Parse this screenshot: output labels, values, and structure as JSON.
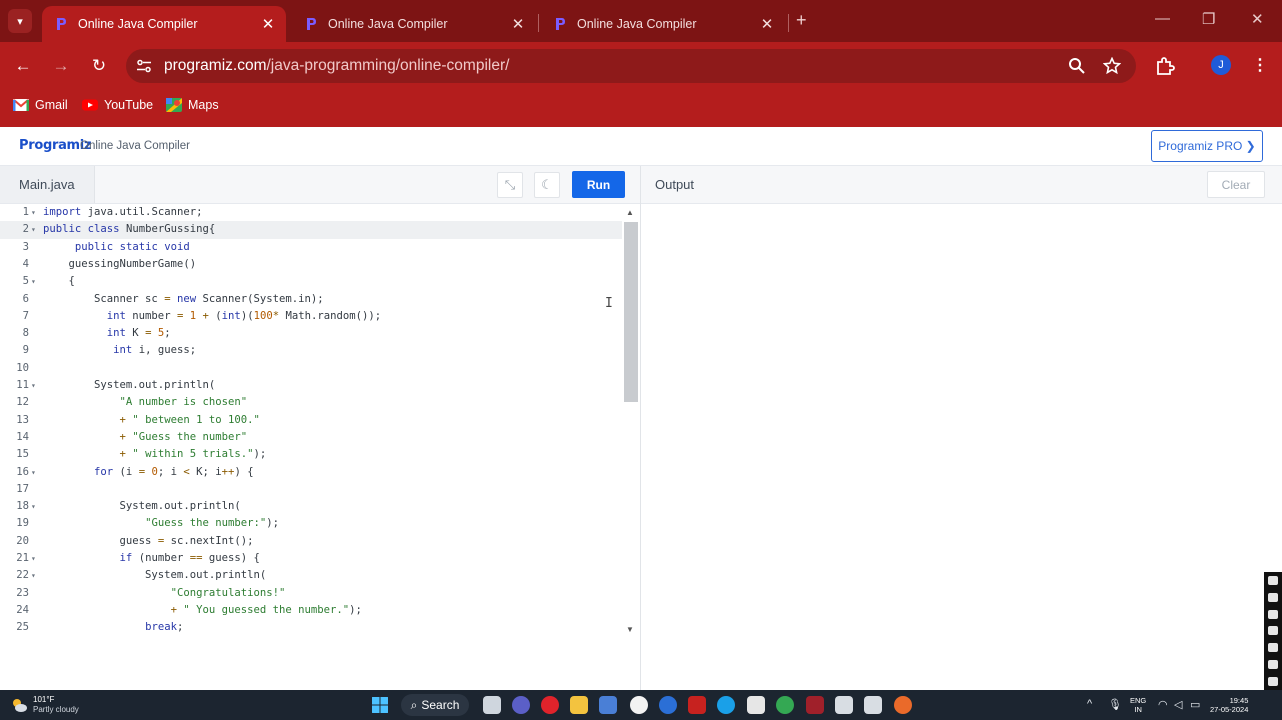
{
  "browser": {
    "tabs": [
      {
        "title": "Online Java Compiler",
        "active": true
      },
      {
        "title": "Online Java Compiler",
        "active": false
      },
      {
        "title": "Online Java Compiler",
        "active": false
      }
    ],
    "url_host": "programiz.com",
    "url_path": "/java-programming/online-compiler/",
    "profile_initial": "J",
    "bookmarks": [
      "Gmail",
      "YouTube",
      "Maps"
    ]
  },
  "site": {
    "logo": "Programiz",
    "title": "Online Java Compiler",
    "pro_button": "Programiz PRO ❯"
  },
  "editor": {
    "file_tab": "Main.java",
    "run_label": "Run",
    "output_label": "Output",
    "clear_label": "Clear",
    "lines": [
      {
        "n": "1",
        "fold": true,
        "text": "import java.util.Scanner;"
      },
      {
        "n": "2",
        "fold": true,
        "text": "public class NumberGussing{"
      },
      {
        "n": "3",
        "fold": false,
        "text": "     public static void"
      },
      {
        "n": "4",
        "fold": false,
        "text": "    guessingNumberGame()"
      },
      {
        "n": "5",
        "fold": true,
        "text": "    {"
      },
      {
        "n": "6",
        "fold": false,
        "text": "        Scanner sc = new Scanner(System.in);"
      },
      {
        "n": "7",
        "fold": false,
        "text": "          int number = 1 + (int)(100* Math.random());"
      },
      {
        "n": "8",
        "fold": false,
        "text": "          int K = 5;"
      },
      {
        "n": "9",
        "fold": false,
        "text": "           int i, guess;"
      },
      {
        "n": "10",
        "fold": false,
        "text": ""
      },
      {
        "n": "11",
        "fold": true,
        "text": "        System.out.println("
      },
      {
        "n": "12",
        "fold": false,
        "text": "            \"A number is chosen\""
      },
      {
        "n": "13",
        "fold": false,
        "text": "            + \" between 1 to 100.\""
      },
      {
        "n": "14",
        "fold": false,
        "text": "            + \"Guess the number\""
      },
      {
        "n": "15",
        "fold": false,
        "text": "            + \" within 5 trials.\");"
      },
      {
        "n": "16",
        "fold": true,
        "text": "        for (i = 0; i < K; i++) {"
      },
      {
        "n": "17",
        "fold": false,
        "text": ""
      },
      {
        "n": "18",
        "fold": true,
        "text": "            System.out.println("
      },
      {
        "n": "19",
        "fold": false,
        "text": "                \"Guess the number:\");"
      },
      {
        "n": "20",
        "fold": false,
        "text": "            guess = sc.nextInt();"
      },
      {
        "n": "21",
        "fold": true,
        "text": "            if (number == guess) {"
      },
      {
        "n": "22",
        "fold": true,
        "text": "                System.out.println("
      },
      {
        "n": "23",
        "fold": false,
        "text": "                    \"Congratulations!\""
      },
      {
        "n": "24",
        "fold": false,
        "text": "                    + \" You guessed the number.\");"
      },
      {
        "n": "25",
        "fold": false,
        "text": "                break;"
      }
    ]
  },
  "taskbar": {
    "temperature": "101°F",
    "weather": "Partly cloudy",
    "search_label": "Search",
    "lang_1": "ENG",
    "lang_2": "IN",
    "time": "19:45",
    "date": "27-05-2024"
  }
}
